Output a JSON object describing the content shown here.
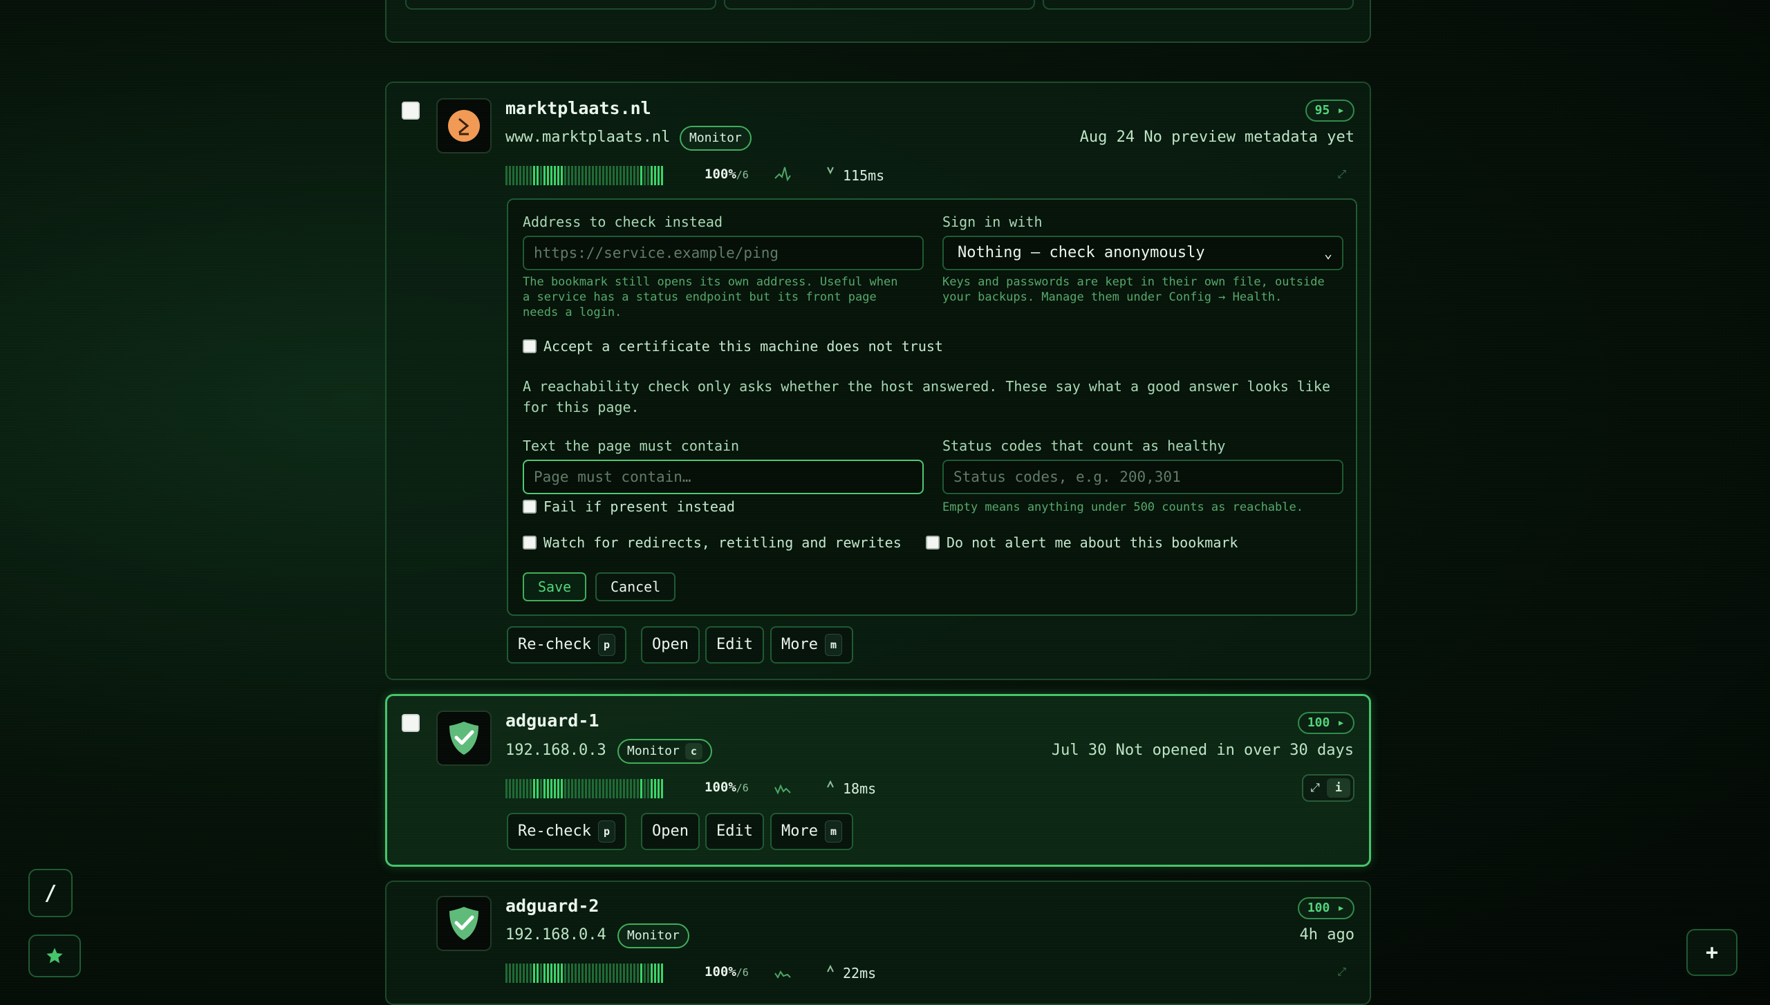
{
  "cards": [
    {
      "title": "marktplaats.nl",
      "host": "www.marktplaats.nl",
      "tag": "Monitor",
      "score": "95 ▸",
      "meta": "Aug 24 No preview metadata yet",
      "uptime_pct": "100%",
      "uptime_den": "/6",
      "latency": "115ms",
      "icon": "marktplaats-logo-icon",
      "actions": {
        "recheck": "Re-check",
        "recheck_key": "p",
        "open": "Open",
        "edit": "Edit",
        "more": "More",
        "more_key": "m"
      }
    },
    {
      "title": "adguard-1",
      "host": "192.168.0.3",
      "tag": "Monitor",
      "tag_key": "c",
      "score": "100 ▸",
      "meta": "Jul 30 Not opened in over 30 days",
      "uptime_pct": "100%",
      "uptime_den": "/6",
      "latency": "18ms",
      "icon": "adguard-shield-icon",
      "info_key": "i",
      "actions": {
        "recheck": "Re-check",
        "recheck_key": "p",
        "open": "Open",
        "edit": "Edit",
        "more": "More",
        "more_key": "m"
      }
    },
    {
      "title": "adguard-2",
      "host": "192.168.0.4",
      "tag": "Monitor",
      "score": "100 ▸",
      "meta": "4h ago",
      "uptime_pct": "100%",
      "uptime_den": "/6",
      "latency": "22ms",
      "icon": "adguard-shield-icon"
    }
  ],
  "edit_panel": {
    "address_label": "Address to check instead",
    "address_placeholder": "https://service.example/ping",
    "address_help_1": "The bookmark still opens its own address. Useful when",
    "address_help_2": "a service has a status endpoint but its front page",
    "address_help_3": "needs a login.",
    "signin_label": "Sign in with",
    "signin_value": "Nothing — check anonymously",
    "signin_help_1": "Keys and passwords are kept in their own file, outside",
    "signin_help_2": "your backups. Manage them under Config → Health.",
    "cert_label": "Accept a certificate this machine does not trust",
    "reach_para_1": "A reachability check only asks whether the host answered. These say what a good answer looks like",
    "reach_para_2": "for this page.",
    "contain_label": "Text the page must contain",
    "contain_placeholder": "Page must contain…",
    "fail_label": "Fail if present instead",
    "status_label": "Status codes that count as healthy",
    "status_placeholder": "Status codes, e.g. 200,301",
    "status_help": "Empty means anything under 500 counts as reachable.",
    "redirects_label": "Watch for redirects, retitling and rewrites",
    "noalert_label": "Do not alert me about this bookmark",
    "save": "Save",
    "cancel": "Cancel"
  },
  "fabs": {
    "search": "/",
    "add": "+"
  },
  "colors": {
    "accent": "#46c46a",
    "bar_ok": "#3bd468",
    "bar_dim": "#1f6a35"
  }
}
